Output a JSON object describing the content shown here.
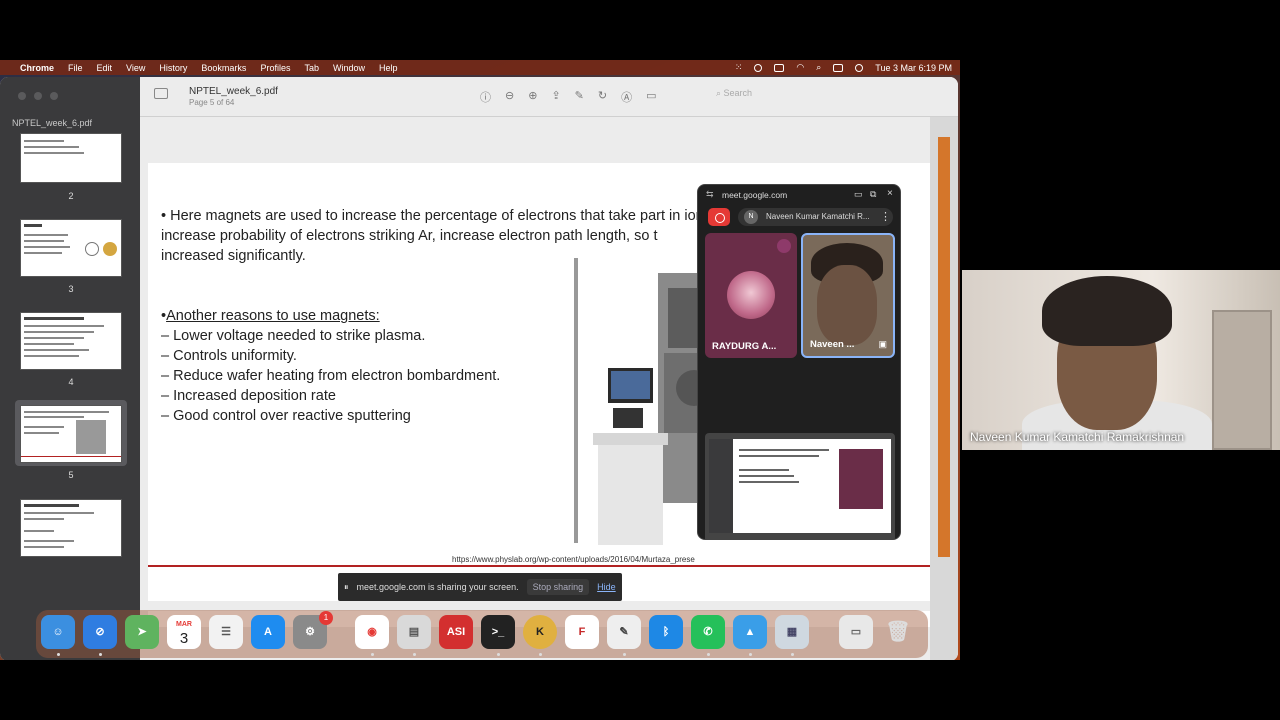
{
  "menubar": {
    "app": "Chrome",
    "items": [
      "File",
      "Edit",
      "View",
      "History",
      "Bookmarks",
      "Profiles",
      "Tab",
      "Window",
      "Help"
    ],
    "clock": "Tue 3 Mar  6:19 PM"
  },
  "preview": {
    "sidebar_title": "NPTEL_week_6.pdf",
    "doc_title": "NPTEL_week_6.pdf",
    "page_info": "Page 5 of 64",
    "search_placeholder": "Search",
    "thumbnails": [
      {
        "num": "2"
      },
      {
        "num": "3",
        "title": "About Me"
      },
      {
        "num": "4"
      },
      {
        "num": "5"
      },
      {
        "num": ""
      }
    ]
  },
  "slide": {
    "p1_line1": "• Here magnets are used to increase the percentage of electrons that take part in ionization events,",
    "p1_line2": "increase probability of electrons striking Ar, increase electron path length, so t",
    "p1_line3": "increased significantly.",
    "heading": "Another reasons to use magnets:",
    "bullets": [
      "– Lower voltage needed to strike plasma.",
      "– Controls uniformity.",
      "– Reduce wafer heating from electron bombardment.",
      "– Increased deposition rate",
      "– Good control over reactive sputtering"
    ],
    "url": "https://www.physlab.org/wp-content/uploads/2016/04/Murtaza_prese"
  },
  "share_bar": {
    "message": "meet.google.com is sharing your screen.",
    "stop": "Stop sharing",
    "hide": "Hide"
  },
  "meet_pip": {
    "url": "meet.google.com",
    "presenter": "Naveen Kumar Kamatchi R...",
    "avatar_initial": "N",
    "tile1_name": "RAYDURG A...",
    "tile2_name": "Naveen ..."
  },
  "dock": {
    "calendar_month": "MAR",
    "calendar_day": "3",
    "badge": "1",
    "asi_label": "ASI"
  },
  "self_view": {
    "name": "Naveen Kumar Kamatchi Ramakrishnan"
  },
  "colors": {
    "accent_red": "#b22222",
    "meet_blue": "#8ab4f8",
    "end_call_red": "#e53935"
  }
}
